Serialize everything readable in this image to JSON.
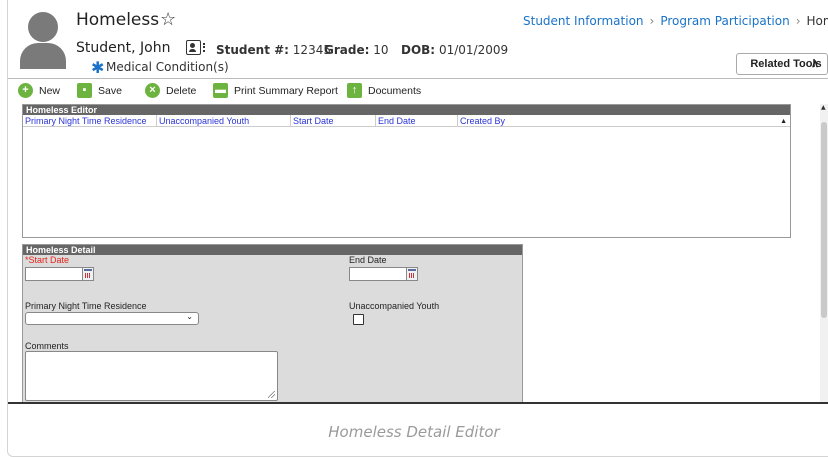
{
  "header": {
    "title": "Homeless",
    "student_name": "Student, John",
    "student_number_label": "Student #:",
    "student_number": "12345",
    "grade_label": "Grade:",
    "grade": "10",
    "dob_label": "DOB:",
    "dob": "01/01/2009",
    "medical": "Medical Condition(s)",
    "related_tools": "Related Tools"
  },
  "breadcrumb": [
    "Student Information",
    "Program Participation",
    "Homeless"
  ],
  "toolbar": {
    "new": "New",
    "save": "Save",
    "delete": "Delete",
    "print": "Print Summary Report",
    "documents": "Documents"
  },
  "editor": {
    "title": "Homeless Editor",
    "columns": [
      "Primary Night Time Residence",
      "Unaccompanied Youth",
      "Start Date",
      "End Date",
      "Created By"
    ]
  },
  "detail": {
    "title": "Homeless Detail",
    "start_date_label": "*Start Date",
    "end_date_label": "End Date",
    "residence_label": "Primary Night Time Residence",
    "residence_value": "",
    "unaccompanied_label": "Unaccompanied Youth",
    "comments_label": "Comments"
  },
  "caption": "Homeless Detail Editor",
  "colors": {
    "link": "#1a73c8",
    "toolbar_icon": "#6cb33f",
    "required": "#e2231a",
    "column_header": "#2b34d6",
    "panel_header": "#666666"
  }
}
